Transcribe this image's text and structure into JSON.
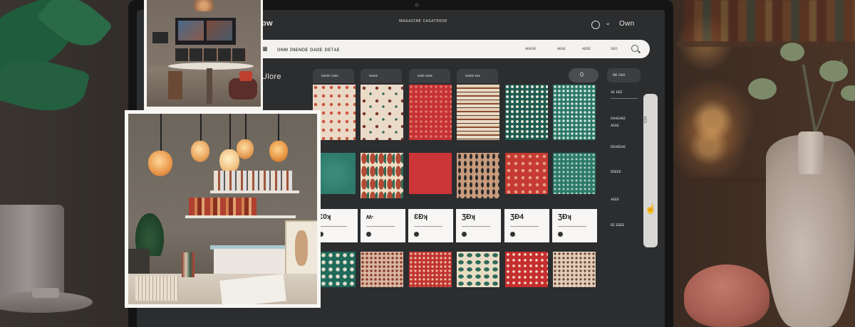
{
  "app": {
    "title": "ɒw",
    "breadcrumb": "ᴍᴀɢᴀᴢɪɴᴇ ᴄᴀɢᴀᴛᴇᴇᴅᴇ",
    "user_name": "Own"
  },
  "search": {
    "value": "ᴏɴᴍ ɪɴᴇɴᴅᴇ ᴅᴀᴅᴇ ᴅᴇᴛᴀᴇ",
    "nav": [
      "ᴀᴇᴀᴏᴇ",
      "ᴀᴇᴀᴇ",
      "ᴀᴇᴇᴇ",
      "ᴏᴇᴏ"
    ]
  },
  "sidebar_left": {
    "title": "Ulore"
  },
  "category_tags": [
    "ᴅᴇᴇᴇᴇ ᴄᴇᴇᴇ",
    "ᴇᴇᴇᴇᴇ",
    "ᴇᴇᴇᴇ ᴇᴇᴇᴇ",
    "ᴇᴇᴇᴇᴇ ᴇᴇᴇ"
  ],
  "filter_pill": {
    "label": "0"
  },
  "side_panel": {
    "button": "ᴅᴇ ᴄᴀᴏ",
    "items": [
      "ᴀᴇ ᴇᴇᴇ",
      "ᴅᴀᴀᴇᴀᴇᴇ",
      "ᴀᴇᴀᴇ",
      "ᴅᴇᴀᴇᴇᴀᴇ",
      "ᴇᴇᴇᴇᴇ",
      "ᴀᴇᴇᴇ",
      "ᴇᴇ ᴇᴇᴇᴇ"
    ]
  },
  "scroll_label": "ᴇᴇᴇ",
  "price_cards": [
    {
      "title": "Ɛ0ʞ"
    },
    {
      "title": "ʍ·"
    },
    {
      "title": "ƐĐʞ"
    },
    {
      "title": "ƷĐʞ"
    },
    {
      "title": "ƷĐ4"
    },
    {
      "title": "ƷĐʞ"
    }
  ],
  "colors": {
    "screen_bg": "#2b2d2f",
    "card_bg": "#f7f6f4",
    "search_bg": "#f3f2f0",
    "red": "#c4373a",
    "teal": "#2f7a6a",
    "cream": "#e9dccb"
  },
  "icons": [
    "user-icon",
    "chevron-down-icon",
    "search-icon",
    "hand-cursor-icon",
    "grid-icon"
  ]
}
